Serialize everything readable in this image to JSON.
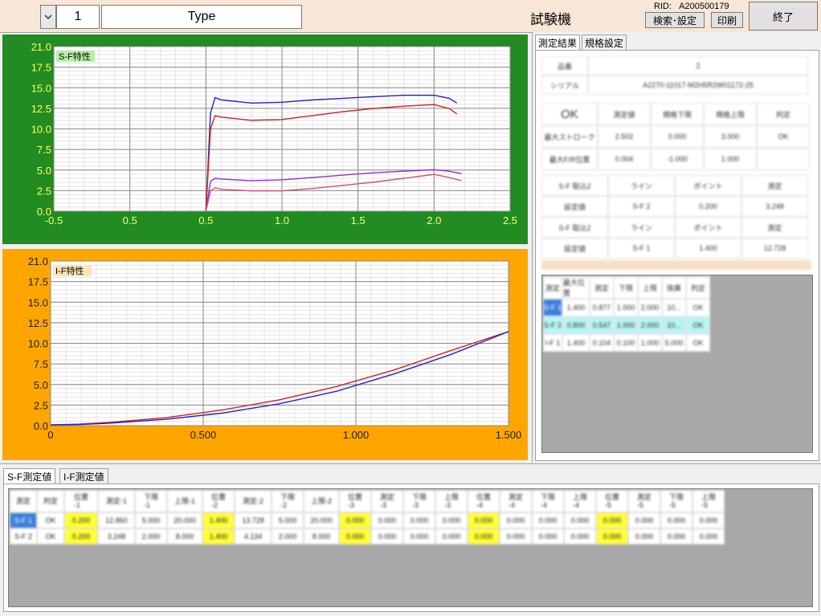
{
  "topbar": {
    "dropdown_icon": "chevron-down-icon",
    "number": "1",
    "type_label": "Type",
    "title": "試験機",
    "rid_label": "RID:",
    "rid_value": "A200500179",
    "search_button": "検索･設定",
    "print_button": "印刷",
    "end_button": "終了"
  },
  "chart_data": [
    {
      "type": "line",
      "title": "S-F特性",
      "xlim": [
        -0.5,
        2.5
      ],
      "ylim": [
        0,
        21
      ],
      "x_ticks": [
        "-0.5",
        "0.5",
        "0.5",
        "1.0",
        "1.5",
        "2.0",
        "2.5"
      ],
      "y_ticks": [
        "0.0",
        "2.5",
        "5.0",
        "7.5",
        "10.0",
        "12.5",
        "15.0",
        "17.5",
        "21.0"
      ],
      "background": "#228b22",
      "series": [
        {
          "color": "#2222cc",
          "x": [
            0.5,
            0.53,
            0.56,
            0.6,
            0.8,
            1.0,
            1.2,
            1.4,
            1.6,
            1.8,
            2.0,
            2.1,
            2.15
          ],
          "y": [
            0,
            12.5,
            14.5,
            14.2,
            13.8,
            13.9,
            14.2,
            14.4,
            14.6,
            14.8,
            14.8,
            14.4,
            13.8
          ]
        },
        {
          "color": "#cc2222",
          "x": [
            0.5,
            0.53,
            0.56,
            0.6,
            0.8,
            1.0,
            1.2,
            1.4,
            1.6,
            1.8,
            2.0,
            2.1,
            2.15
          ],
          "y": [
            0,
            10.5,
            12.2,
            12.0,
            11.6,
            11.7,
            12.2,
            12.7,
            13.1,
            13.4,
            13.6,
            13.1,
            12.4
          ]
        },
        {
          "color": "#8833cc",
          "x": [
            0.5,
            0.53,
            0.56,
            0.6,
            0.8,
            1.0,
            1.2,
            1.4,
            1.6,
            1.8,
            2.0,
            2.1,
            2.18
          ],
          "y": [
            0,
            3.8,
            4.2,
            4.1,
            3.9,
            4.0,
            4.3,
            4.6,
            4.9,
            5.1,
            5.3,
            5.1,
            4.8
          ]
        },
        {
          "color": "#cc5577",
          "x": [
            0.5,
            0.53,
            0.56,
            0.6,
            0.8,
            1.0,
            1.2,
            1.4,
            1.6,
            1.8,
            2.0,
            2.1,
            2.18
          ],
          "y": [
            0,
            2.6,
            3.0,
            2.8,
            2.6,
            2.6,
            2.9,
            3.3,
            3.7,
            4.2,
            4.7,
            4.3,
            3.9
          ]
        }
      ]
    },
    {
      "type": "line",
      "title": "I-F特性",
      "xlim": [
        0,
        1.6
      ],
      "ylim": [
        0,
        21
      ],
      "x_ticks": [
        "0",
        "0.500",
        "1.000",
        "1.500"
      ],
      "y_ticks": [
        "0.0",
        "2.5",
        "5.0",
        "7.5",
        "10.0",
        "12.5",
        "15.0",
        "17.5",
        "21.0"
      ],
      "background": "#ffa500",
      "series": [
        {
          "color": "#cc2222",
          "x": [
            0,
            0.1,
            0.2,
            0.4,
            0.6,
            0.8,
            1.0,
            1.2,
            1.4,
            1.6
          ],
          "y": [
            0.1,
            0.2,
            0.4,
            1.0,
            2.0,
            3.3,
            5.0,
            7.1,
            9.6,
            12.0
          ]
        },
        {
          "color": "#2222cc",
          "x": [
            0,
            0.1,
            0.2,
            0.4,
            0.6,
            0.8,
            1.0,
            1.2,
            1.4,
            1.6
          ],
          "y": [
            0.1,
            0.15,
            0.3,
            0.8,
            1.6,
            2.8,
            4.4,
            6.6,
            9.1,
            12.0
          ]
        }
      ]
    }
  ],
  "right_panel": {
    "tabs": [
      "測定結果",
      "規格設定"
    ],
    "active_tab": "測定結果",
    "info_rows": [
      [
        "品番",
        "2"
      ],
      [
        "シリアル",
        "A2270-11017-M2H5R2W01172-25"
      ]
    ],
    "result_header": [
      "OK",
      "測定値",
      "規格下限",
      "規格上限",
      "判定"
    ],
    "result_rows": [
      [
        "最大ストローク",
        "2.502",
        "0.000",
        "3.000",
        "OK"
      ],
      [
        "最大F/R位置",
        "0.004",
        "-1.000",
        "1.000",
        ""
      ]
    ],
    "sf_rows": [
      [
        "S-F 取込2",
        "ライン",
        "ポイント",
        "測定"
      ],
      [
        "設定値",
        "S-F 2",
        "0.200",
        "3.248"
      ],
      [
        "S-F 取込2",
        "ライン",
        "ポイント",
        "測定"
      ],
      [
        "設定値",
        "S-F 1",
        "1.400",
        "12.728"
      ]
    ],
    "grid_header": [
      "測定",
      "最大位置",
      "測定",
      "下限",
      "上限",
      "換算",
      "判定"
    ],
    "grid_rows": [
      [
        "S-F 1",
        "1.400",
        "0.877",
        "1.000",
        "2.000",
        "10...",
        "OK"
      ],
      [
        "S-F 2",
        "0.800",
        "0.547",
        "1.000",
        "2.000",
        "10...",
        "OK"
      ],
      [
        "I-F 1",
        "1.400",
        "0.104",
        "0.100",
        "1.000",
        "5.000",
        "OK"
      ]
    ]
  },
  "bottom_panel": {
    "tabs": [
      "S-F測定値",
      "I-F測定値"
    ],
    "active_tab": "S-F測定値",
    "headers": [
      "測定",
      "判定",
      "位置\n-1",
      "測定-1",
      "下限\n-1",
      "上限-1",
      "位置\n-2",
      "測定-2",
      "下限\n-2",
      "上限-2",
      "位置\n-3",
      "測定\n-3",
      "下限\n-3",
      "上限\n-3",
      "位置\n-4",
      "測定\n-4",
      "下限\n-4",
      "上限\n-4",
      "位置\n-5",
      "測定\n-5",
      "下限\n-5",
      "上限\n-5"
    ],
    "rows": [
      [
        "S-F 1",
        "OK",
        "0.200",
        "12.860",
        "5.000",
        "20.000",
        "1.400",
        "13.728",
        "5.000",
        "20.000",
        "0.000",
        "0.000",
        "0.000",
        "0.000",
        "0.000",
        "0.000",
        "0.000",
        "0.000",
        "0.000",
        "0.000",
        "0.000",
        "0.000"
      ],
      [
        "S-F 2",
        "OK",
        "0.200",
        "3.248",
        "2.000",
        "8.000",
        "1.400",
        "4.134",
        "2.000",
        "8.000",
        "0.000",
        "0.000",
        "0.000",
        "0.000",
        "0.000",
        "0.000",
        "0.000",
        "0.000",
        "0.000",
        "0.000",
        "0.000",
        "0.000"
      ]
    ]
  }
}
